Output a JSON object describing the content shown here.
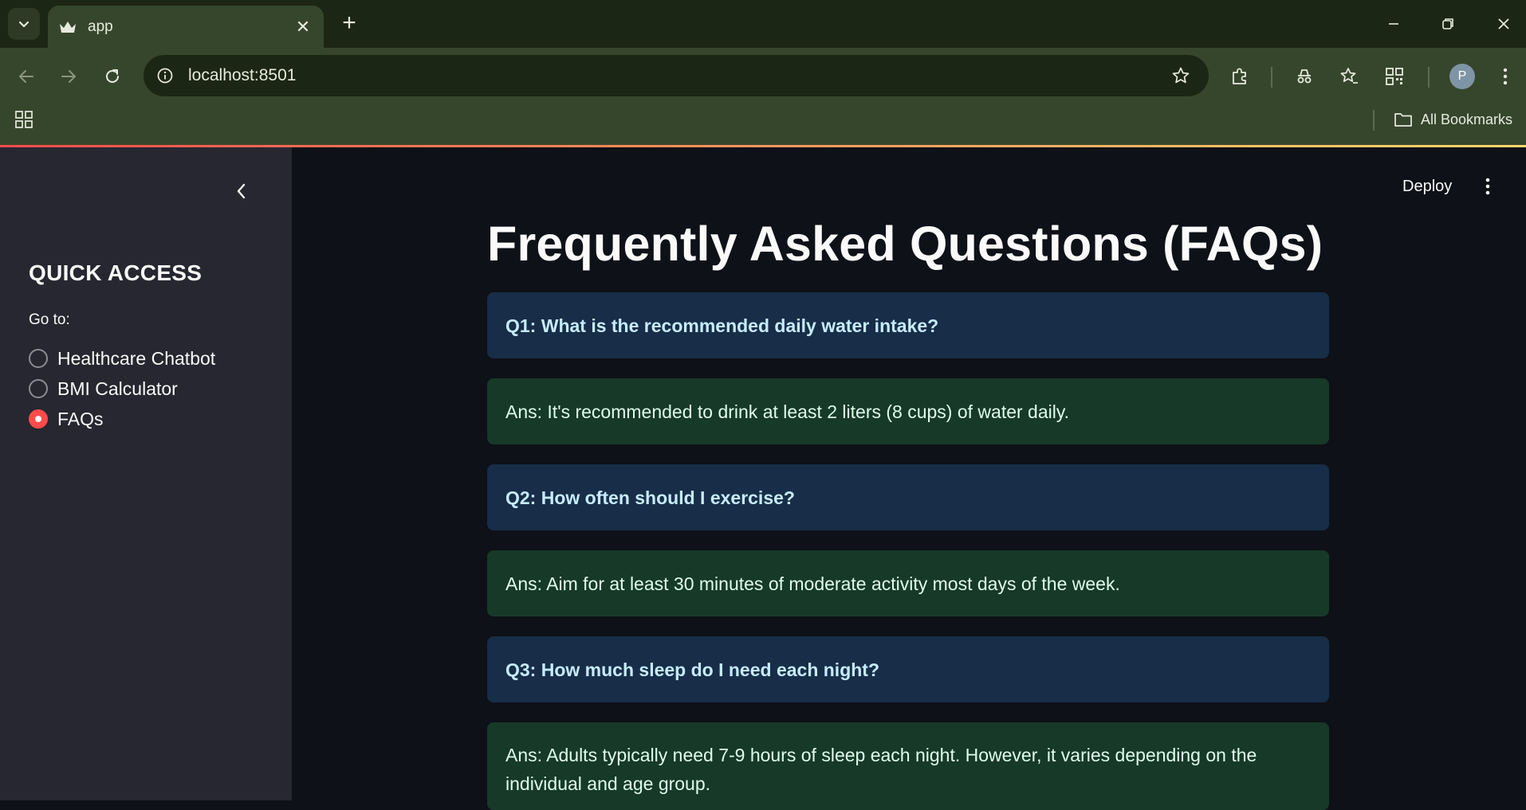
{
  "browser": {
    "tab_title": "app",
    "tab_close": "✕",
    "new_tab": "+",
    "url": "localhost:8501",
    "profile_initial": "P",
    "bookmarks_label": "All Bookmarks"
  },
  "sidebar": {
    "header": "QUICK ACCESS",
    "radio_label": "Go to:",
    "options": [
      {
        "label": "Healthcare Chatbot",
        "selected": false
      },
      {
        "label": "BMI Calculator",
        "selected": false
      },
      {
        "label": "FAQs",
        "selected": true
      }
    ]
  },
  "main": {
    "deploy_label": "Deploy",
    "title": "Frequently Asked Questions (FAQs)",
    "faqs": [
      {
        "question": "Q1: What is the recommended daily water intake?",
        "answer": "Ans: It's recommended to drink at least 2 liters (8 cups) of water daily."
      },
      {
        "question": "Q2: How often should I exercise?",
        "answer": "Ans: Aim for at least 30 minutes of moderate activity most days of the week."
      },
      {
        "question": "Q3: How much sleep do I need each night?",
        "answer": "Ans: Adults typically need 7-9 hours of sleep each night. However, it varies depending on the individual and age group."
      }
    ]
  },
  "colors": {
    "accent": "#ff4b4b",
    "question_bg": "#172d48",
    "question_text": "#c7ebff",
    "answer_bg": "#173928",
    "answer_text": "#dffde9",
    "sidebar_bg": "#262730",
    "main_bg": "#0e1117"
  }
}
